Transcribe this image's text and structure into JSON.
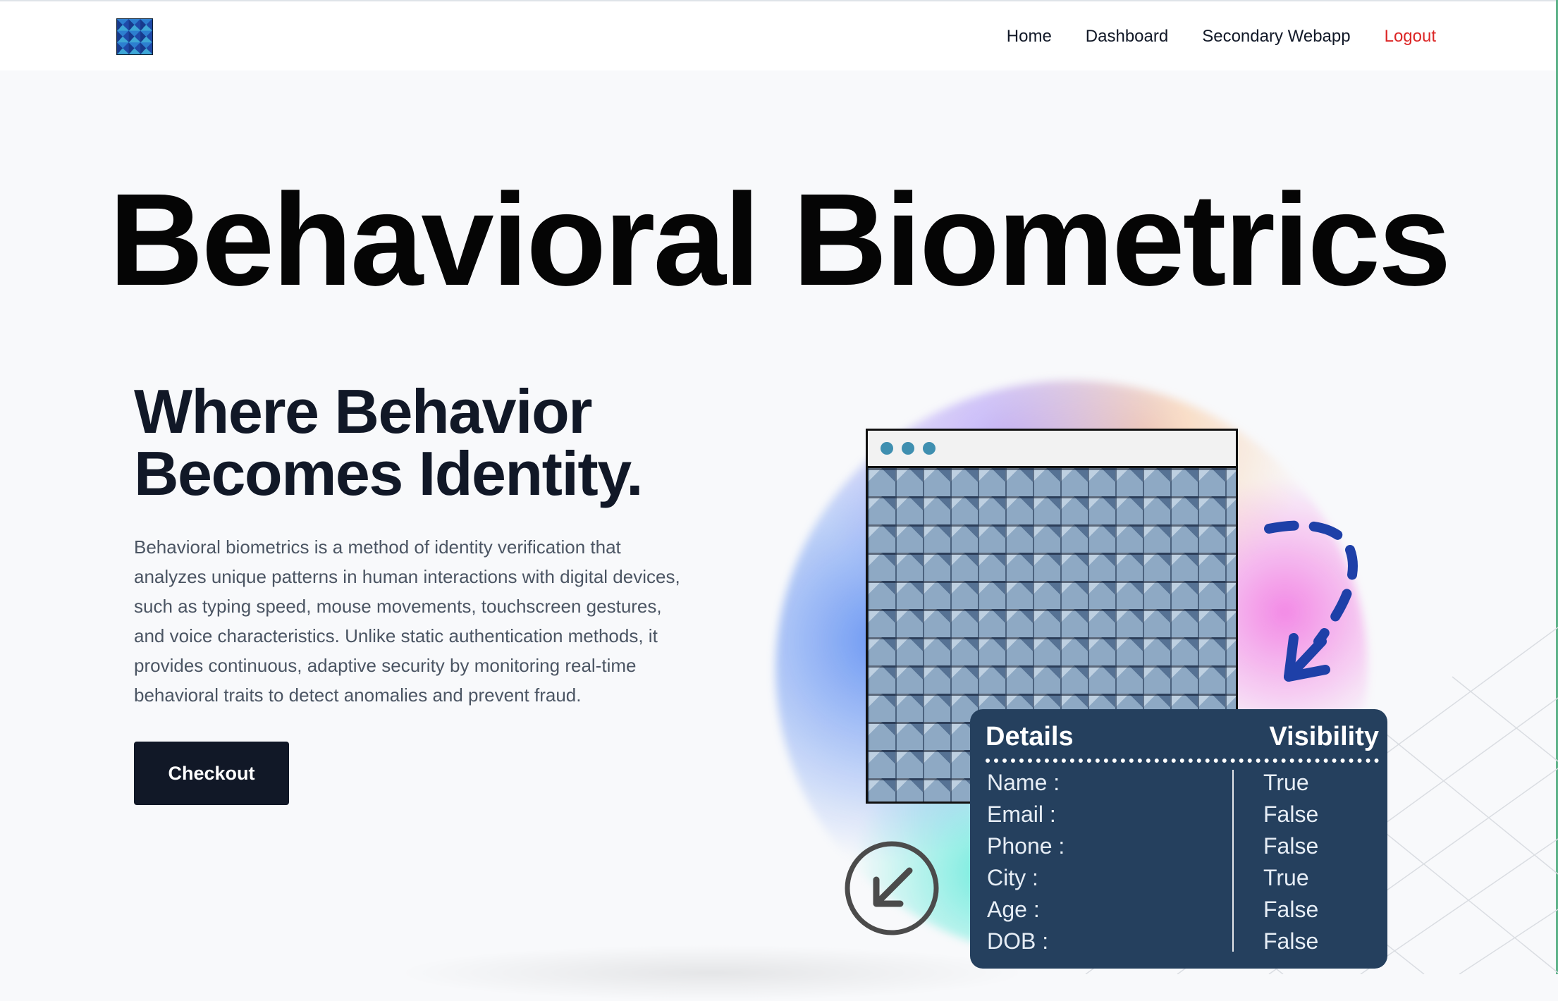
{
  "nav": {
    "links": [
      "Home",
      "Dashboard",
      "Secondary Webapp",
      "Logout"
    ]
  },
  "hero": {
    "title": "Behavioral Biometrics",
    "headline_line1": "Where Behavior",
    "headline_line2": "Becomes Identity.",
    "description": "Behavioral biometrics is a method of identity verification that analyzes unique patterns in human interactions with digital devices, such as typing speed, mouse movements, touchscreen gestures, and voice characteristics. Unlike static authentication methods, it provides continuous, adaptive security by monitoring real-time behavioral traits to detect anomalies and prevent fraud.",
    "cta_label": "Checkout"
  },
  "details_card": {
    "title": "Details",
    "visibility_title": "Visibility",
    "rows": [
      {
        "field": "Name :",
        "value": "True"
      },
      {
        "field": "Email :",
        "value": "False"
      },
      {
        "field": "Phone :",
        "value": "False"
      },
      {
        "field": "City :",
        "value": "True"
      },
      {
        "field": "Age :",
        "value": "False"
      },
      {
        "field": "DOB :",
        "value": "False"
      }
    ]
  },
  "colors": {
    "accent_dark": "#111827",
    "logout": "#dc2626",
    "card_bg": "#25405e",
    "arrow_blue": "#1e40a8"
  },
  "icons": [
    "logo-icon",
    "window-dots-icon",
    "dashed-curved-arrow-icon",
    "down-left-arrow-circle-icon"
  ]
}
